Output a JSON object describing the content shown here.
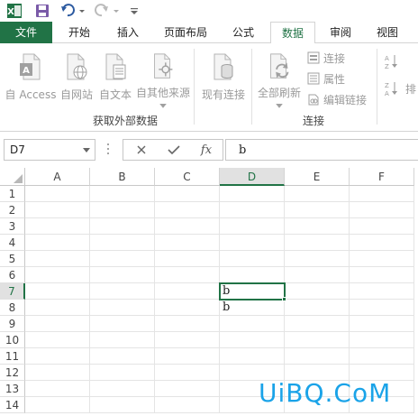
{
  "quick_access": {
    "items": [
      "excel-logo",
      "save",
      "undo",
      "redo",
      "customize"
    ]
  },
  "ribbon_tabs": [
    {
      "label": "文件"
    },
    {
      "label": "开始"
    },
    {
      "label": "插入"
    },
    {
      "label": "页面布局"
    },
    {
      "label": "公式"
    },
    {
      "label": "数据"
    },
    {
      "label": "审阅"
    },
    {
      "label": "视图"
    }
  ],
  "ribbon": {
    "external_data": {
      "buttons": [
        "自 Access",
        "自网站",
        "自文本",
        "自其他来源"
      ],
      "group_label": "获取外部数据"
    },
    "existing_connections": "现有连接",
    "connections": {
      "refresh_all": "全部刷新",
      "connections": "连接",
      "properties": "属性",
      "edit_links": "编辑链接",
      "group_label": "连接"
    },
    "sort": {
      "partial_label": "排"
    }
  },
  "formula_bar": {
    "name_box": "D7",
    "fx_label": "fx",
    "content": "b"
  },
  "grid": {
    "columns": [
      "A",
      "B",
      "C",
      "D",
      "E",
      "F"
    ],
    "rows": [
      "1",
      "2",
      "3",
      "4",
      "5",
      "6",
      "7",
      "8",
      "9",
      "10",
      "11",
      "12",
      "13",
      "14"
    ],
    "active_column": "D",
    "active_row": "7",
    "cells": {
      "D7": "b",
      "D8": "b"
    }
  },
  "watermark": "UiBQ.CoM",
  "colors": {
    "accent": "#217346",
    "disabled_text": "#9a9a9a",
    "watermark": "#1aa3e8"
  }
}
